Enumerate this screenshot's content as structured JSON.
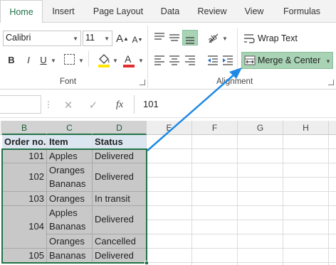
{
  "ribbon_tabs": [
    "Home",
    "Insert",
    "Page Layout",
    "Data",
    "Review",
    "View",
    "Formulas"
  ],
  "font": {
    "name": "Calibri",
    "size": "11",
    "group_label": "Font",
    "bold": "B",
    "italic": "I",
    "underline": "U"
  },
  "alignment": {
    "wrap_text": "Wrap Text",
    "merge_center": "Merge & Center",
    "group_label": "Alignment"
  },
  "formula_bar": {
    "fx": "fx",
    "value": "101"
  },
  "columns": [
    "B",
    "C",
    "D",
    "E",
    "F",
    "G",
    "H"
  ],
  "table": {
    "headers": [
      "Order no.",
      "Item",
      "Status"
    ],
    "rows": [
      {
        "order": "101",
        "item": [
          "Apples"
        ],
        "status": "Delivered"
      },
      {
        "order": "102",
        "item": [
          "Oranges",
          "Bananas"
        ],
        "status": "Delivered"
      },
      {
        "order": "103",
        "item": [
          "Oranges"
        ],
        "status": "In transit"
      },
      {
        "order": "104",
        "item": [
          "Apples",
          "Bananas"
        ],
        "status": "Delivered"
      },
      {
        "order": "",
        "item": [
          "Oranges"
        ],
        "status": "Cancelled"
      },
      {
        "order": "105",
        "item": [
          "Bananas"
        ],
        "status": "Delivered"
      }
    ]
  },
  "colors": {
    "accent": "#217346",
    "arrow": "#1e88e5",
    "selection": "#c8c8c8",
    "header_fill": "#dce6f1",
    "merge_button": "#a9d3b5"
  }
}
